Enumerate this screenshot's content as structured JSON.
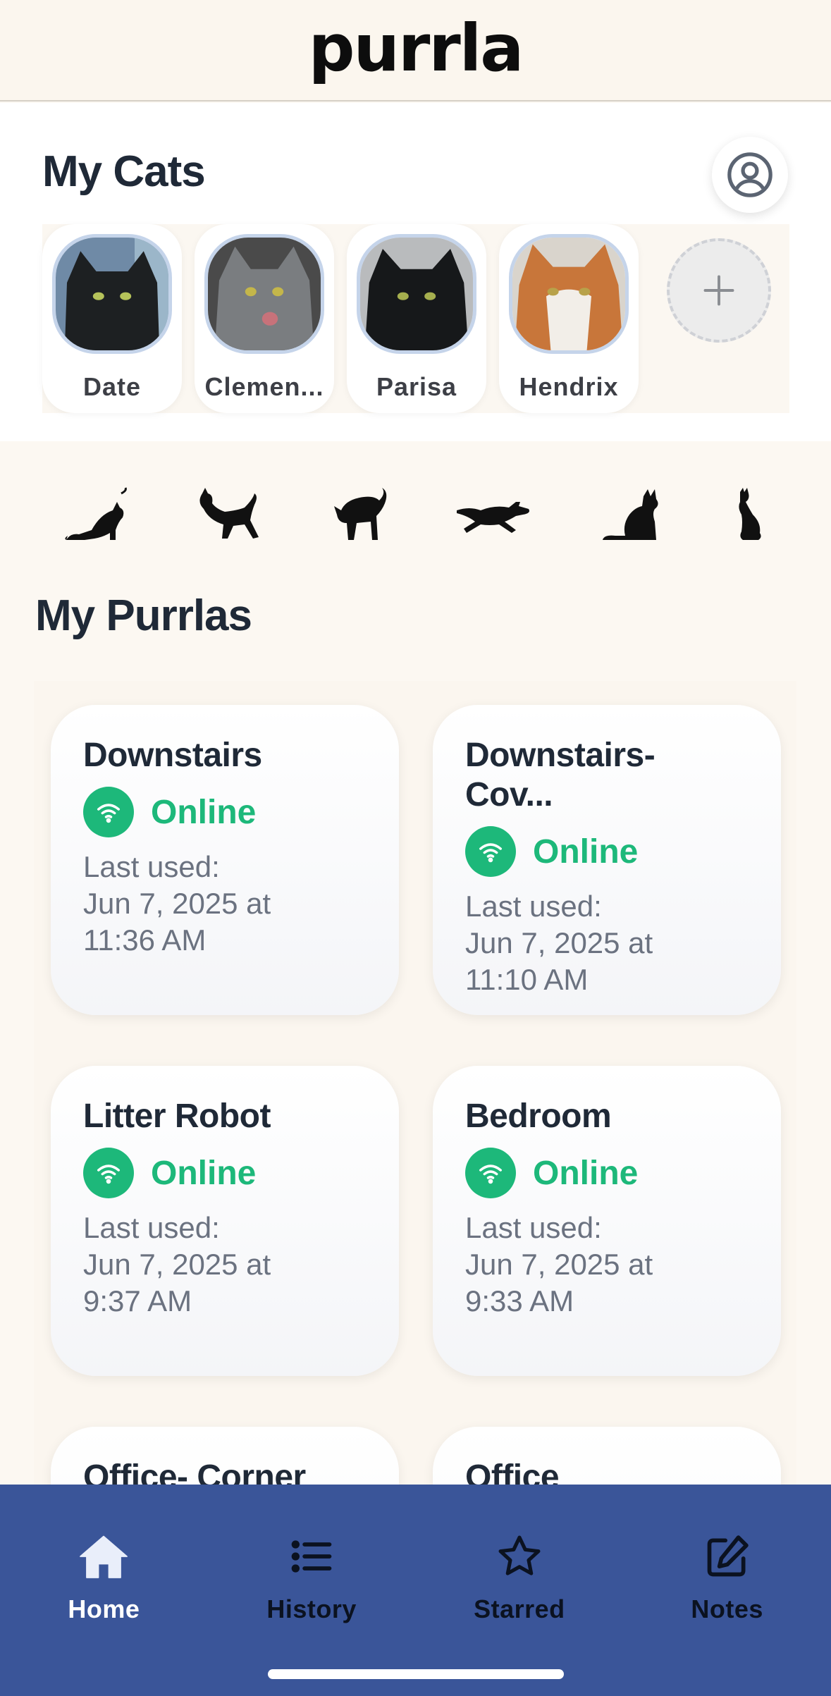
{
  "app": {
    "logo": "purrla"
  },
  "cats_section": {
    "title": "My Cats",
    "cats": [
      {
        "name": "Date"
      },
      {
        "name": "Clemen..."
      },
      {
        "name": "Parisa"
      },
      {
        "name": "Hendrix"
      }
    ],
    "add_icon": "plus-icon",
    "profile_icon": "user-circle-icon"
  },
  "purrlas_section": {
    "title": "My Purrlas",
    "devices": [
      {
        "name": "Downstairs",
        "status": "Online",
        "last_used_label": "Last used:",
        "last_used_date": "Jun 7, 2025 at",
        "last_used_time": "11:36 AM"
      },
      {
        "name": "Downstairs-Cov...",
        "status": "Online",
        "last_used_label": "Last used:",
        "last_used_date": "Jun 7, 2025 at",
        "last_used_time": "11:10 AM"
      },
      {
        "name": "Litter Robot",
        "status": "Online",
        "last_used_label": "Last used:",
        "last_used_date": "Jun 7, 2025 at",
        "last_used_time": "9:37 AM"
      },
      {
        "name": "Bedroom",
        "status": "Online",
        "last_used_label": "Last used:",
        "last_used_date": "Jun 7, 2025 at",
        "last_used_time": "9:33 AM"
      },
      {
        "name": "Office- Corner"
      },
      {
        "name": "Office"
      }
    ]
  },
  "tabbar": {
    "tabs": [
      {
        "label": "Home",
        "icon": "home-icon",
        "active": true
      },
      {
        "label": "History",
        "icon": "list-icon"
      },
      {
        "label": "Starred",
        "icon": "star-icon"
      },
      {
        "label": "Notes",
        "icon": "edit-icon"
      }
    ]
  },
  "colors": {
    "online": "#1db87a",
    "tabbar": "#3a5599",
    "background": "#fcf8f2"
  }
}
